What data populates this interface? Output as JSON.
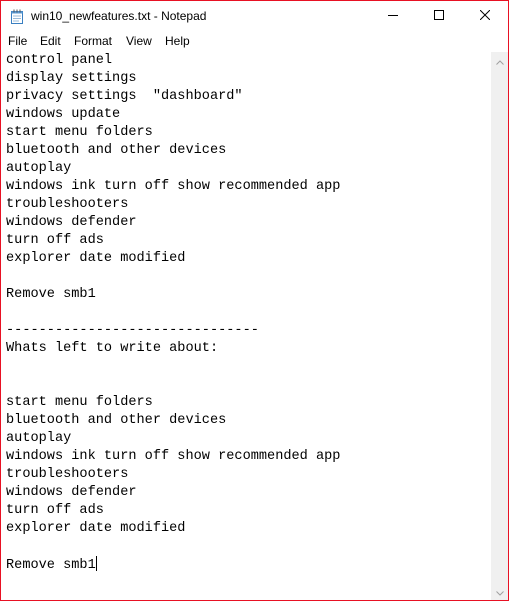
{
  "window": {
    "title": "win10_newfeatures.txt - Notepad"
  },
  "menu": {
    "items": [
      "File",
      "Edit",
      "Format",
      "View",
      "Help"
    ]
  },
  "editor": {
    "lines": [
      "control panel",
      "display settings",
      "privacy settings  \"dashboard\"",
      "windows update",
      "start menu folders",
      "bluetooth and other devices",
      "autoplay",
      "windows ink turn off show recommended app",
      "troubleshooters",
      "windows defender",
      "turn off ads",
      "explorer date modified",
      "",
      "Remove smb1",
      "",
      "-------------------------------",
      "Whats left to write about:",
      "",
      "",
      "start menu folders",
      "bluetooth and other devices",
      "autoplay",
      "windows ink turn off show recommended app",
      "troubleshooters",
      "windows defender",
      "turn off ads",
      "explorer date modified",
      "",
      "Remove smb1"
    ]
  },
  "icons": {
    "app": "notepad-icon",
    "minimize": "minimize-icon",
    "maximize": "maximize-icon",
    "close": "close-icon"
  },
  "colors": {
    "window_border": "#e81123",
    "scrollbar_track": "#f0f0f0"
  }
}
